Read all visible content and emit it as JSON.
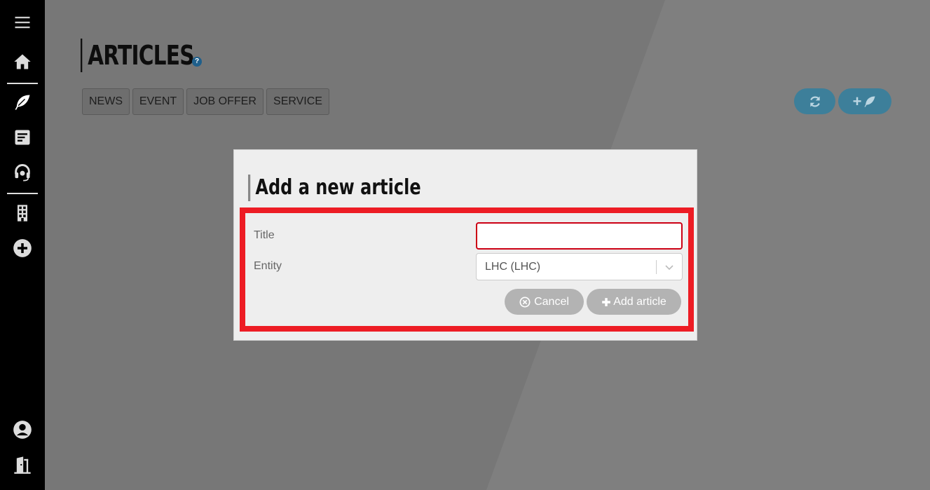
{
  "page": {
    "title": "ARTICLES",
    "help_glyph": "?"
  },
  "sidebar": {
    "icons": [
      "menu-icon",
      "home-icon",
      "feather-icon",
      "document-icon",
      "headset-icon",
      "building-icon",
      "plus-circle-icon",
      "user-icon",
      "logout-door-icon"
    ]
  },
  "filters": [
    {
      "label": "NEWS"
    },
    {
      "label": "EVENT"
    },
    {
      "label": "JOB OFFER"
    },
    {
      "label": "SERVICE"
    }
  ],
  "actions": {
    "refresh_icon": "refresh-icon",
    "add_glyph": "+"
  },
  "modal": {
    "title": "Add a new article",
    "fields": {
      "title_label": "Title",
      "title_value": "",
      "entity_label": "Entity",
      "entity_value": "LHC (LHC)"
    },
    "buttons": {
      "cancel": "Cancel",
      "add": "Add article"
    }
  },
  "colors": {
    "highlight": "#ed1c24",
    "accent": "#3d7f9a",
    "sidebar": "#000000"
  }
}
